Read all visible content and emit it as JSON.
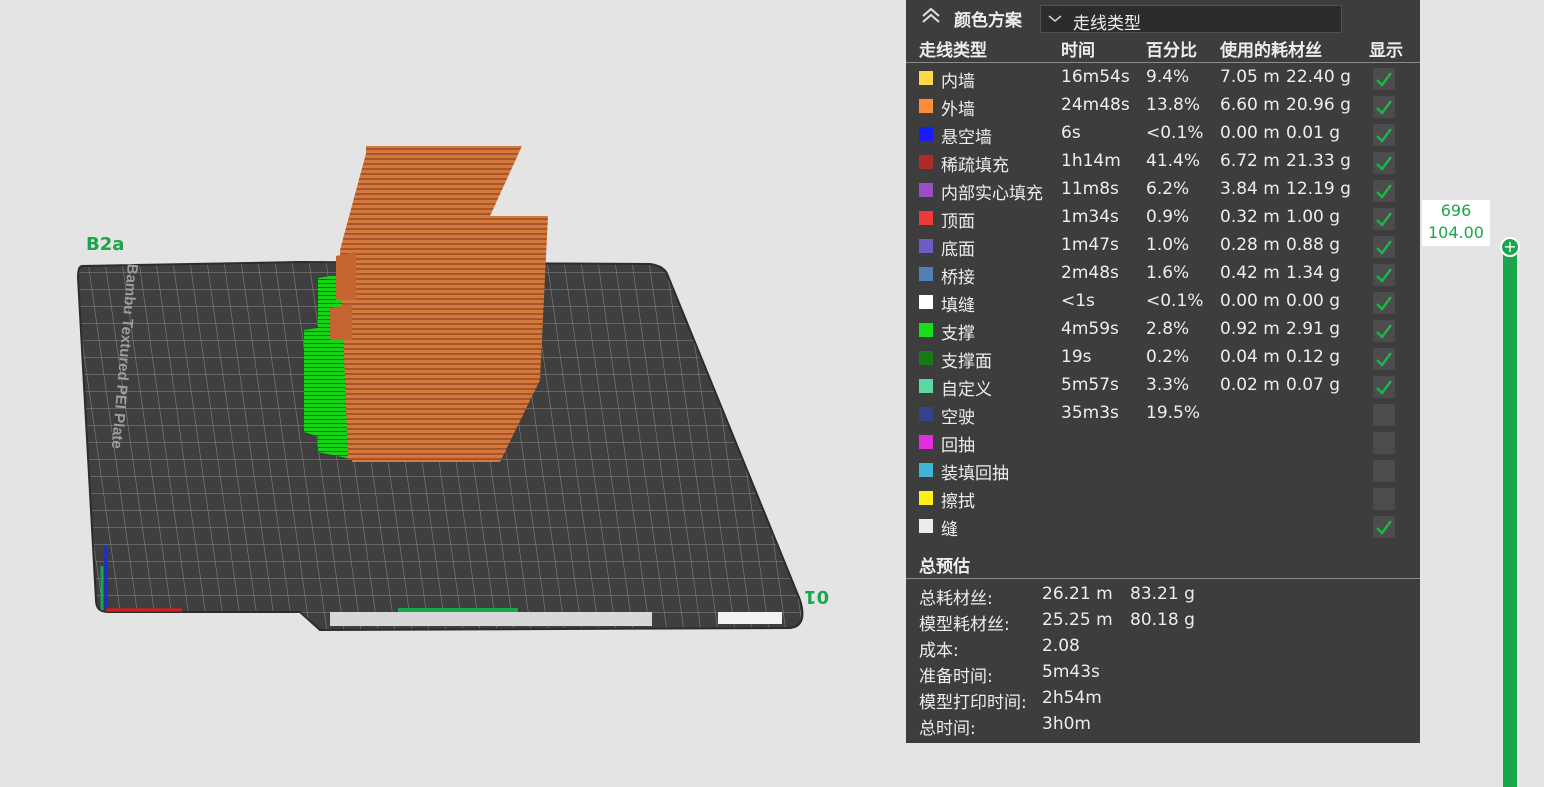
{
  "viewport": {
    "plate_name": "B2a",
    "plate_number": "01",
    "plate_brand": "Bambu Textured PEI Plate"
  },
  "legend": {
    "title": "颜色方案",
    "scheme_select": "走线类型",
    "headers": {
      "type": "走线类型",
      "time": "时间",
      "percent": "百分比",
      "filament": "使用的耗材丝",
      "show": "显示"
    },
    "rows": [
      {
        "name": "内墙",
        "color": "#ffd84a",
        "time": "16m54s",
        "percent": "9.4%",
        "length": "7.05 m",
        "weight": "22.40 g",
        "visible": true
      },
      {
        "name": "外墙",
        "color": "#ff8c3a",
        "time": "24m48s",
        "percent": "13.8%",
        "length": "6.60 m",
        "weight": "20.96 g",
        "visible": true
      },
      {
        "name": "悬空墙",
        "color": "#1a1aff",
        "time": "6s",
        "percent": "<0.1%",
        "length": "0.00 m",
        "weight": "0.01 g",
        "visible": true
      },
      {
        "name": "稀疏填充",
        "color": "#b02a2a",
        "time": "1h14m",
        "percent": "41.4%",
        "length": "6.72 m",
        "weight": "21.33 g",
        "visible": true
      },
      {
        "name": "内部实心填充",
        "color": "#9a4fc9",
        "time": "11m8s",
        "percent": "6.2%",
        "length": "3.84 m",
        "weight": "12.19 g",
        "visible": true
      },
      {
        "name": "顶面",
        "color": "#f03a3a",
        "time": "1m34s",
        "percent": "0.9%",
        "length": "0.32 m",
        "weight": "1.00 g",
        "visible": true
      },
      {
        "name": "底面",
        "color": "#6e5cc4",
        "time": "1m47s",
        "percent": "1.0%",
        "length": "0.28 m",
        "weight": "0.88 g",
        "visible": true
      },
      {
        "name": "桥接",
        "color": "#4f7fb4",
        "time": "2m48s",
        "percent": "1.6%",
        "length": "0.42 m",
        "weight": "1.34 g",
        "visible": true
      },
      {
        "name": "填缝",
        "color": "#ffffff",
        "time": "<1s",
        "percent": "<0.1%",
        "length": "0.00 m",
        "weight": "0.00 g",
        "visible": true
      },
      {
        "name": "支撑",
        "color": "#18e018",
        "time": "4m59s",
        "percent": "2.8%",
        "length": "0.92 m",
        "weight": "2.91 g",
        "visible": true
      },
      {
        "name": "支撑面",
        "color": "#167a16",
        "time": "19s",
        "percent": "0.2%",
        "length": "0.04 m",
        "weight": "0.12 g",
        "visible": true
      },
      {
        "name": "自定义",
        "color": "#5ed8a0",
        "time": "5m57s",
        "percent": "3.3%",
        "length": "0.02 m",
        "weight": "0.07 g",
        "visible": true
      },
      {
        "name": "空驶",
        "color": "#33448c",
        "time": "35m3s",
        "percent": "19.5%",
        "length": "",
        "weight": "",
        "visible": false
      },
      {
        "name": "回抽",
        "color": "#e02ee0",
        "time": "",
        "percent": "",
        "length": "",
        "weight": "",
        "visible": false
      },
      {
        "name": "装填回抽",
        "color": "#3fb4d6",
        "time": "",
        "percent": "",
        "length": "",
        "weight": "",
        "visible": false
      },
      {
        "name": "擦拭",
        "color": "#ffef1a",
        "time": "",
        "percent": "",
        "length": "",
        "weight": "",
        "visible": false
      },
      {
        "name": "缝",
        "color": "#ececec",
        "time": "",
        "percent": "",
        "length": "",
        "weight": "",
        "visible": true
      }
    ],
    "summary_title": "总预估",
    "summary": [
      {
        "label": "总耗材丝:",
        "v1": "26.21 m",
        "v2": "83.21 g"
      },
      {
        "label": "模型耗材丝:",
        "v1": "25.25 m",
        "v2": "80.18 g"
      },
      {
        "label": "成本:",
        "v1": "2.08",
        "v2": ""
      },
      {
        "label": "准备时间:",
        "v1": "5m43s",
        "v2": ""
      },
      {
        "label": "模型打印时间:",
        "v1": "2h54m",
        "v2": ""
      },
      {
        "label": "总时间:",
        "v1": "3h0m",
        "v2": ""
      }
    ]
  },
  "slider": {
    "layer": "696",
    "height": "104.00"
  }
}
